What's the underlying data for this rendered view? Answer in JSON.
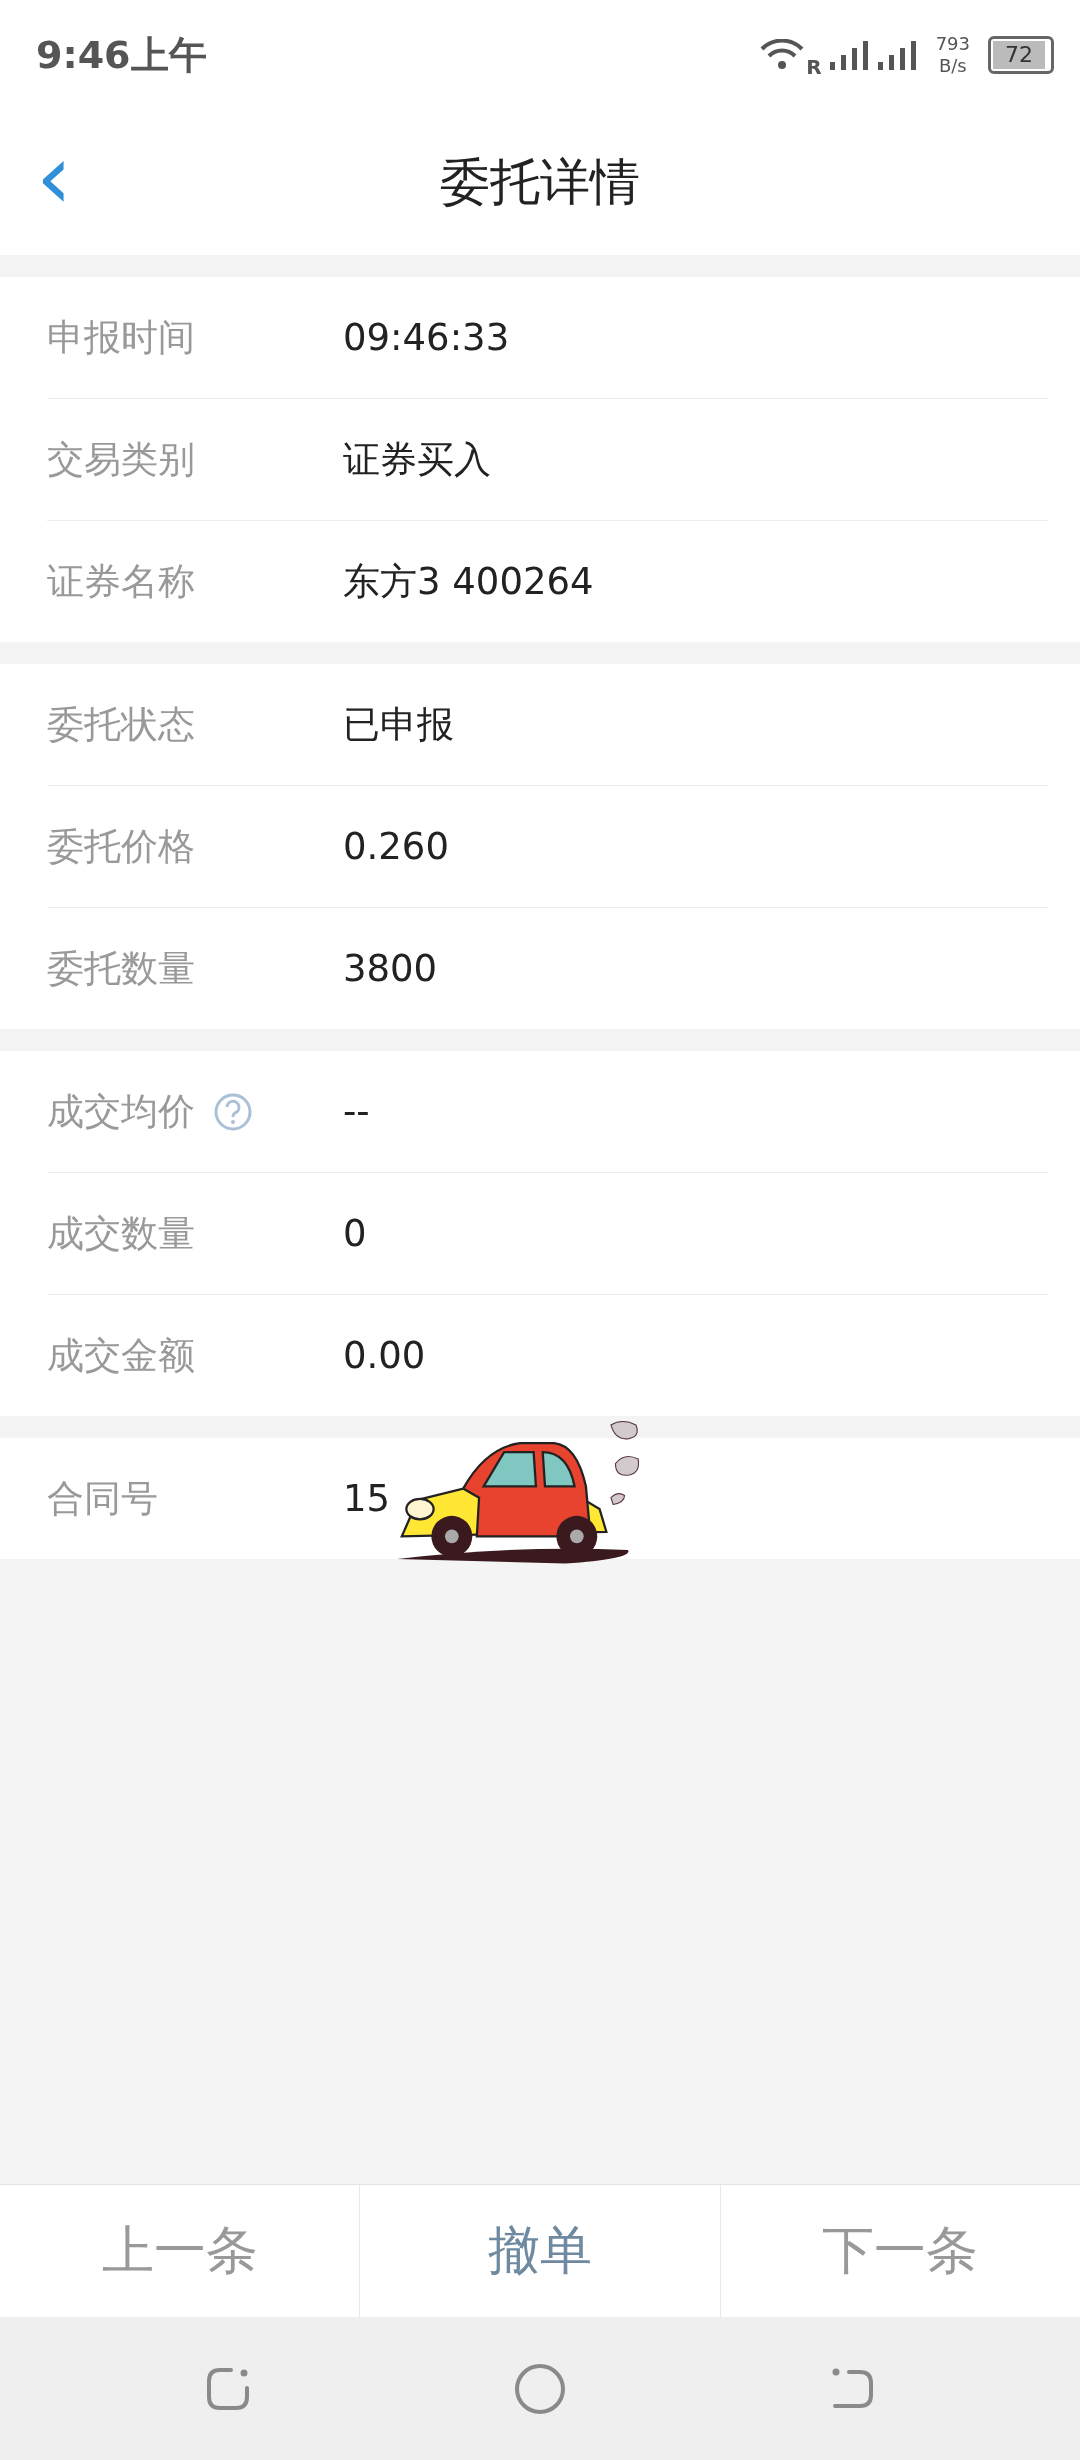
{
  "status_bar": {
    "time": "9:46上午",
    "roaming": "R",
    "speed_value": "793",
    "speed_unit": "B/s",
    "battery": "72"
  },
  "header": {
    "back": "‹",
    "title": "委托详情"
  },
  "sections": [
    {
      "rows": [
        {
          "label": "申报时间",
          "value": "09:46:33",
          "help": false
        },
        {
          "label": "交易类别",
          "value": "证券买入",
          "help": false
        },
        {
          "label": "证券名称",
          "value": "东方3 400264",
          "help": false
        }
      ]
    },
    {
      "rows": [
        {
          "label": "委托状态",
          "value": "已申报",
          "help": false
        },
        {
          "label": "委托价格",
          "value": "0.260",
          "help": false
        },
        {
          "label": "委托数量",
          "value": "3800",
          "help": false
        }
      ]
    },
    {
      "rows": [
        {
          "label": "成交均价",
          "value": "--",
          "help": true
        },
        {
          "label": "成交数量",
          "value": "0",
          "help": false
        },
        {
          "label": "成交金额",
          "value": "0.00",
          "help": false
        }
      ]
    },
    {
      "rows": [
        {
          "label": "合同号",
          "value": "15",
          "help": false
        }
      ]
    }
  ],
  "actions": [
    {
      "label": "上一条",
      "kind": "nav"
    },
    {
      "label": "撤单",
      "kind": "primary"
    },
    {
      "label": "下一条",
      "kind": "nav"
    }
  ]
}
